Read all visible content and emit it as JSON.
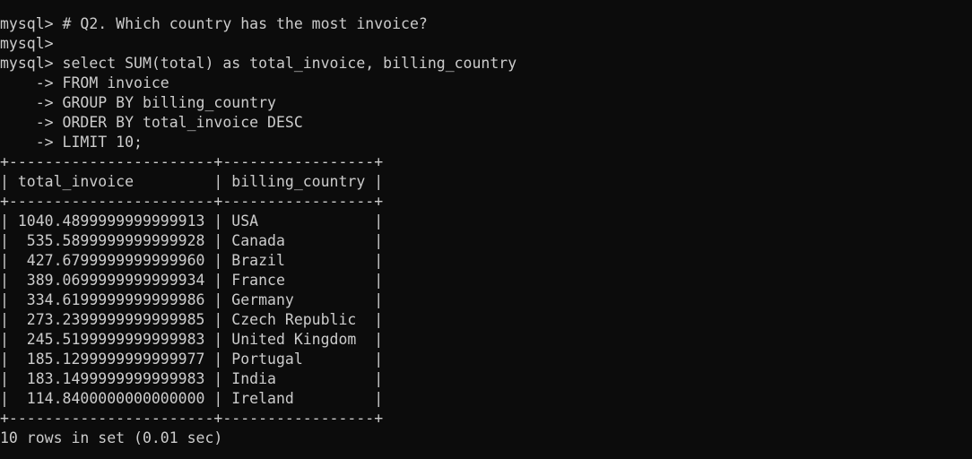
{
  "terminal": {
    "background": "#0c0c0c",
    "text_color": "#cccccc",
    "lines": [
      "mysql> # Q2. Which country has the most invoice?",
      "mysql>",
      "mysql> select SUM(total) as total_invoice, billing_country",
      "    -> FROM invoice",
      "    -> GROUP BY billing_country",
      "    -> ORDER BY total_invoice DESC",
      "    -> LIMIT 10;"
    ],
    "result": {
      "border": "+-----------------------+-----------------+",
      "header": "| total_invoice         | billing_country |",
      "rows": [
        "| 1040.4899999999999913 | USA             |",
        "|  535.5899999999999928 | Canada          |",
        "|  427.6799999999999960 | Brazil          |",
        "|  389.0699999999999934 | France          |",
        "|  334.6199999999999986 | Germany         |",
        "|  273.2399999999999985 | Czech Republic  |",
        "|  245.5199999999999983 | United Kingdom  |",
        "|  185.1299999999999977 | Portugal        |",
        "|  183.1499999999999983 | India           |",
        "|  114.8400000000000000 | Ireland         |"
      ],
      "footer": "10 rows in set (0.01 sec)"
    }
  }
}
